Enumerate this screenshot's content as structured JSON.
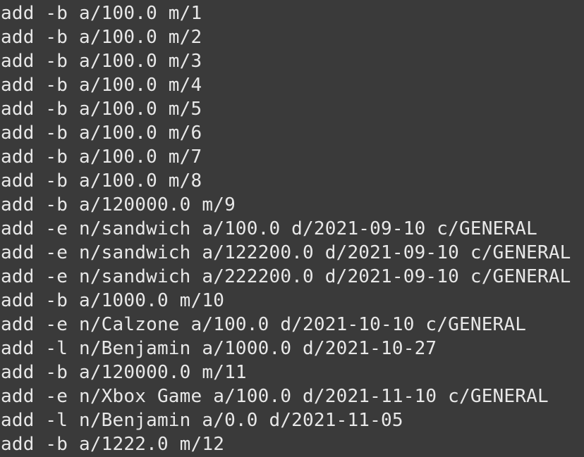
{
  "terminal": {
    "lines": [
      "add -b a/100.0 m/1",
      "add -b a/100.0 m/2",
      "add -b a/100.0 m/3",
      "add -b a/100.0 m/4",
      "add -b a/100.0 m/5",
      "add -b a/100.0 m/6",
      "add -b a/100.0 m/7",
      "add -b a/100.0 m/8",
      "add -b a/120000.0 m/9",
      "add -e n/sandwich a/100.0 d/2021-09-10 c/GENERAL",
      "add -e n/sandwich a/122200.0 d/2021-09-10 c/GENERAL",
      "add -e n/sandwich a/222200.0 d/2021-09-10 c/GENERAL",
      "add -b a/1000.0 m/10",
      "add -e n/Calzone a/100.0 d/2021-10-10 c/GENERAL",
      "add -l n/Benjamin a/1000.0 d/2021-10-27",
      "add -b a/120000.0 m/11",
      "add -e n/Xbox Game a/100.0 d/2021-11-10 c/GENERAL",
      "add -l n/Benjamin a/0.0 d/2021-11-05",
      "add -b a/1222.0 m/12"
    ]
  }
}
